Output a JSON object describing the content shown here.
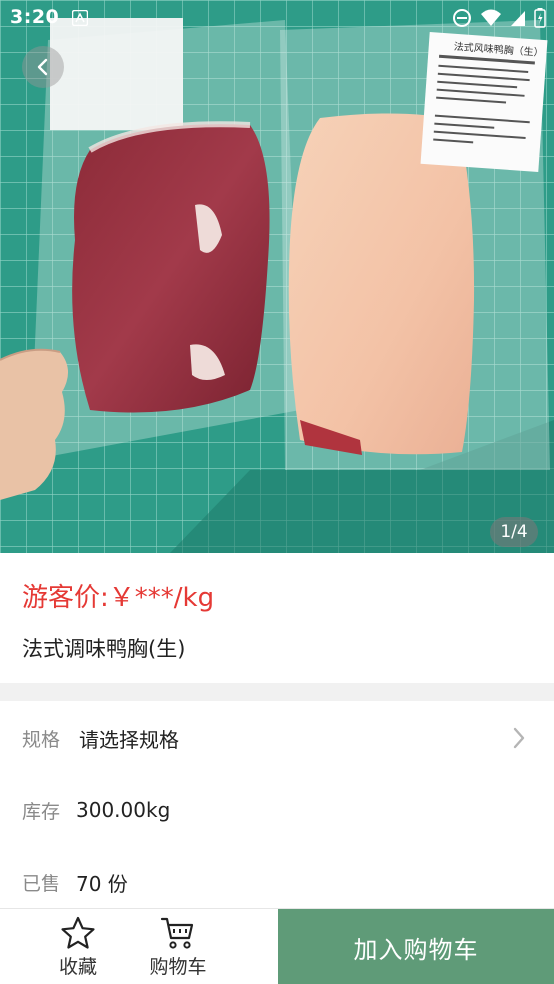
{
  "status_bar": {
    "time": "3:20",
    "icons": [
      "notification-a-icon",
      "do-not-disturb-icon",
      "wifi-icon",
      "signal-icon",
      "battery-icon"
    ]
  },
  "gallery": {
    "current": 1,
    "total": 4,
    "indicator": "1/4",
    "label_text_cn": "法式风味鸭胸（生）"
  },
  "product": {
    "price_label": "游客价:",
    "price_value": "￥***/kg",
    "title": "法式调味鸭胸(生)"
  },
  "specs": {
    "spec_label": "规格",
    "spec_value": "请选择规格",
    "stock_label": "库存",
    "stock_value": "300.00kg",
    "sold_label": "已售",
    "sold_value": "70 份"
  },
  "bottom_bar": {
    "favorite_label": "收藏",
    "cart_label": "购物车",
    "add_to_cart_label": "加入购物车"
  },
  "colors": {
    "price_red": "#e53935",
    "accent_green": "#5f9b78"
  }
}
